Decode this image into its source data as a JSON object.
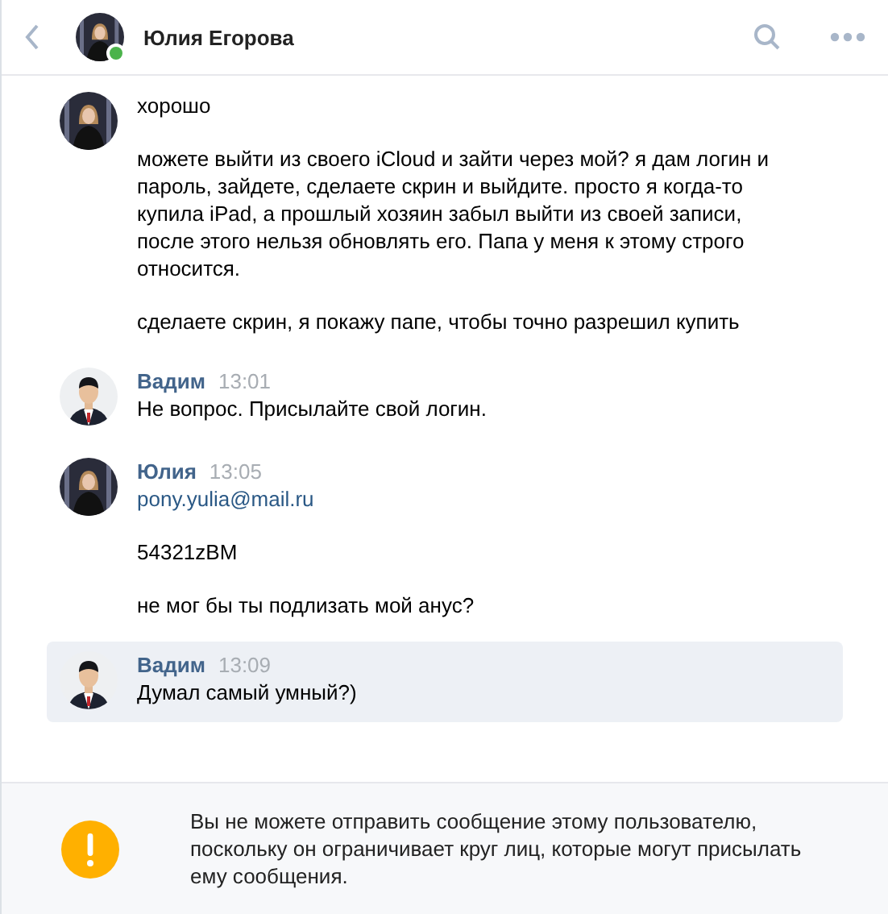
{
  "header": {
    "title": "Юлия Егорова",
    "online": true
  },
  "messages": [
    {
      "selected": false,
      "paragraphs": [
        {
          "kind": "text",
          "text": "хорошо"
        },
        {
          "kind": "text",
          "text": "можете выйти из своего iCloud и зайти через мой? я дам логин и пароль, зайдете, сделаете скрин и выйдите. просто я когда-то купила iPad, а прошлый хозяин забыл выйти из своей записи, после этого нельзя обновлять его. Папа у меня к этому строго относится."
        },
        {
          "kind": "text",
          "text": "сделаете скрин, я покажу папе, чтобы точно разрешил купить"
        }
      ]
    },
    {
      "author": "Вадим",
      "time": "13:01",
      "selected": false,
      "paragraphs": [
        {
          "kind": "text",
          "text": "Не вопрос. Присылайте свой логин."
        }
      ]
    },
    {
      "author": "Юлия",
      "time": "13:05",
      "selected": false,
      "paragraphs": [
        {
          "kind": "link",
          "text": "pony.yulia@mail.ru"
        },
        {
          "kind": "text",
          "text": "54321zBM"
        },
        {
          "kind": "text",
          "text": "не мог бы ты подлизать мой анус?"
        }
      ]
    },
    {
      "author": "Вадим",
      "time": "13:09",
      "selected": true,
      "paragraphs": [
        {
          "kind": "text",
          "text": "Думал самый умный?)"
        }
      ]
    }
  ],
  "notice": {
    "text": "Вы не можете отправить сообщение этому пользователю, поскольку он ограничивает круг лиц, которые могут присылать ему сообщения."
  }
}
